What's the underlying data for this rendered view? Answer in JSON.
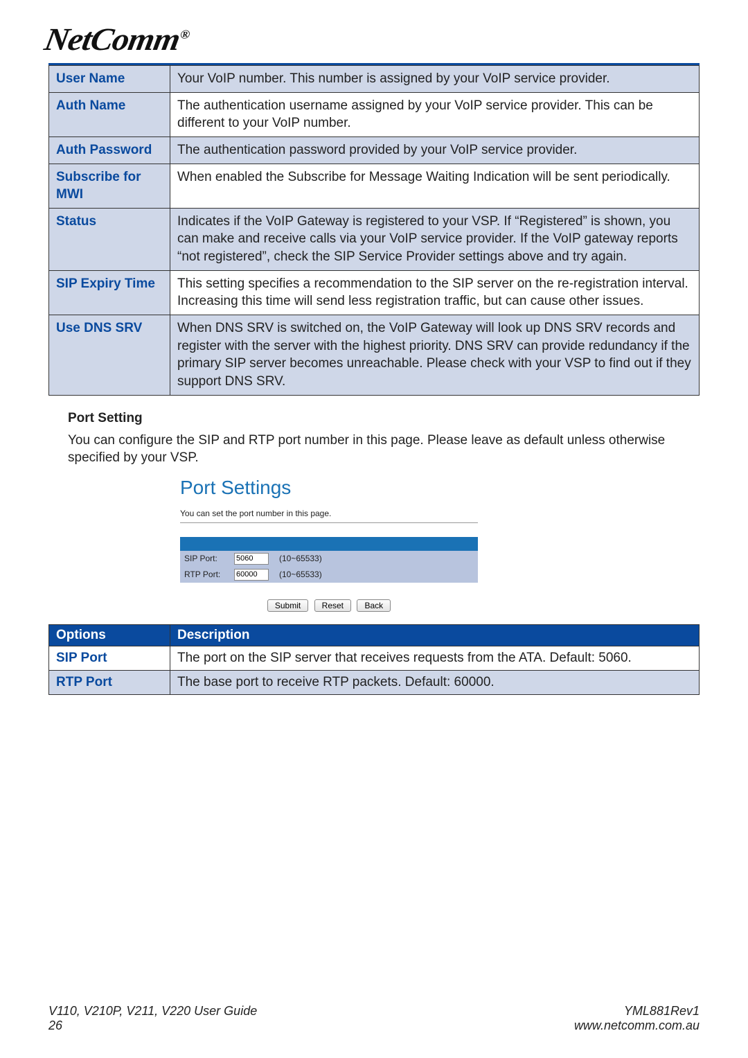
{
  "brand": "NetComm",
  "reg_mark": "®",
  "spec_rows": [
    {
      "k": "User Name",
      "v": "Your VoIP number. This number is assigned by your VoIP service provider."
    },
    {
      "k": "Auth Name",
      "v": "The authentication username assigned by your VoIP service provider. This can be different to your VoIP number."
    },
    {
      "k": "Auth Password",
      "v": "The authentication password provided by your VoIP service provider."
    },
    {
      "k": "Subscribe for MWI",
      "v": "When enabled the Subscribe for Message Waiting Indication will be sent periodically."
    },
    {
      "k": "Status",
      "v": "Indicates if the VoIP Gateway is registered to your VSP. If “Registered” is shown, you can make and receive calls via your VoIP service provider. If the VoIP gateway reports “not registered”, check the SIP Service Provider settings above and try again."
    },
    {
      "k": "SIP Expiry Time",
      "v": "This setting specifies a recommendation to the SIP server on the re-registration interval. Increasing this time will send less registration traffic, but can cause other issues."
    },
    {
      "k": "Use DNS SRV",
      "v": "When DNS SRV is switched on, the VoIP Gateway will look up DNS SRV records and register with the server with the highest priority. DNS SRV can provide redundancy if the primary SIP server becomes unreachable. Please check with your VSP to find out if they support DNS SRV."
    }
  ],
  "port_heading": "Port Setting",
  "port_body": "You can configure the SIP and RTP port number in this page. Please leave as default unless otherwise specified by your VSP.",
  "shot": {
    "title": "Port Settings",
    "line": "You can set the port number in this page.",
    "rows": [
      {
        "label": "SIP Port:",
        "value": "5060",
        "range": "(10~65533)"
      },
      {
        "label": "RTP Port:",
        "value": "60000",
        "range": "(10~65533)"
      }
    ],
    "buttons": {
      "submit": "Submit",
      "reset": "Reset",
      "back": "Back"
    }
  },
  "opt_headers": {
    "c1": "Options",
    "c2": "Description"
  },
  "opt_rows": [
    {
      "k": "SIP Port",
      "v": "The port on the SIP server that receives requests from the ATA. Default: 5060."
    },
    {
      "k": "RTP Port",
      "v": "The base port to receive RTP packets. Default: 60000."
    }
  ],
  "footer": {
    "left_top": "V110, V210P, V211, V220 User Guide",
    "left_bottom": "26",
    "right_top": "YML881Rev1",
    "right_bottom": "www.netcomm.com.au"
  }
}
